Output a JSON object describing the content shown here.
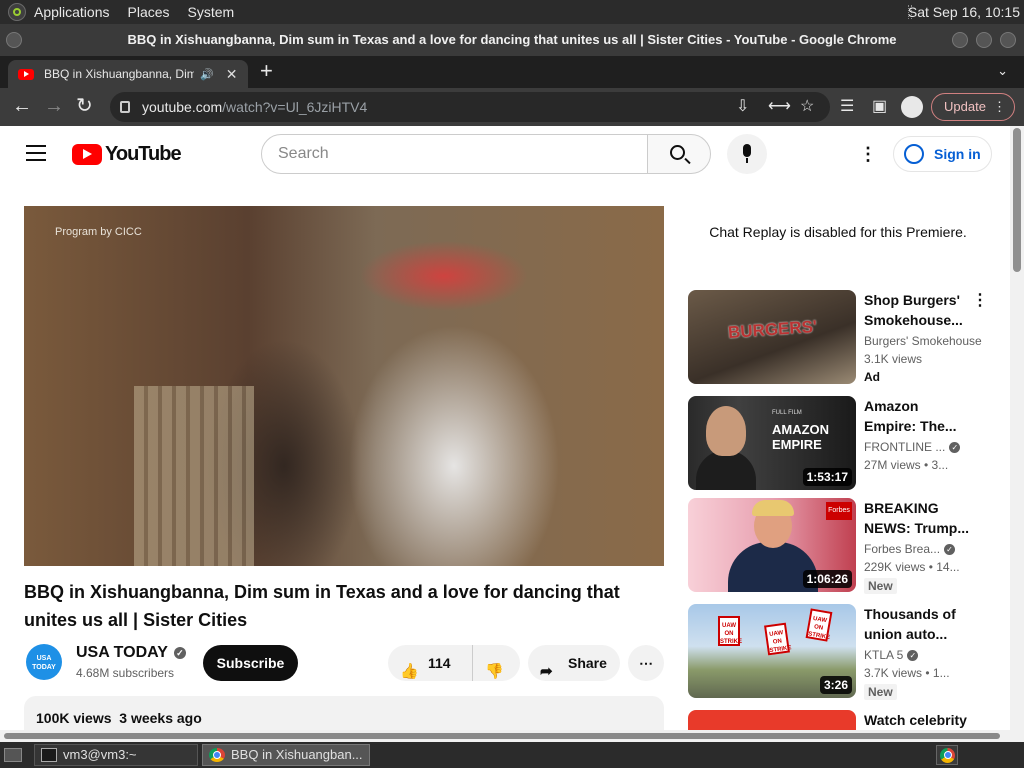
{
  "desktop": {
    "menus": [
      "Applications",
      "Places",
      "System"
    ],
    "clock": "Sat Sep 16, 10:15"
  },
  "window": {
    "title": "BBQ in Xishuangbanna, Dim sum in Texas and a love for dancing that unites us all | Sister Cities - YouTube - Google Chrome"
  },
  "browser": {
    "tab_title": "BBQ in Xishuangbanna, Dim sum in Texas and a love for dancing that unites us all | Sister Cities - YouTube",
    "url_domain": "youtube.com",
    "url_path": "/watch?v=Ul_6JziHTV4",
    "update_label": "Update"
  },
  "youtube": {
    "logo_text": "YouTube",
    "search_placeholder": "Search",
    "signin_label": "Sign in",
    "video": {
      "watermark": "Program by CICC",
      "title": "BBQ in Xishuangbanna, Dim sum in Texas and a love for dancing that unites us all | Sister Cities",
      "channel": "USA TODAY",
      "avatar_text": "USA TODAY",
      "subscribers": "4.68M subscribers",
      "subscribe_label": "Subscribe",
      "likes": "114",
      "share_label": "Share",
      "views": "100K views",
      "age": "3 weeks ago"
    },
    "chat_replay": "Chat Replay is disabled for this Premiere.",
    "recommendations": [
      {
        "title1": "Shop Burgers'",
        "title2": "Smokehouse...",
        "channel": "Burgers' Smokehouse",
        "meta": "3.1K views",
        "badge": "Ad",
        "thumb_text": "BURGERS'"
      },
      {
        "title1": "Amazon",
        "title2": "Empire: The...",
        "channel": "FRONTLINE ...",
        "meta": "27M views • 3...",
        "duration": "1:53:17",
        "thumb_big": "AMAZON EMPIRE",
        "thumb_small": "FULL FILM"
      },
      {
        "title1": "BREAKING",
        "title2": "NEWS: Trump...",
        "channel": "Forbes Brea...",
        "meta": "229K views • 14...",
        "duration": "1:06:26",
        "badge": "New",
        "thumb_text": "Forbes"
      },
      {
        "title1": "Thousands of",
        "title2": "union auto...",
        "channel": "KTLA 5",
        "meta": "3.7K views • 1...",
        "duration": "3:26",
        "badge": "New",
        "thumb_text": "UAW ON STRIKE"
      },
      {
        "title1": "Watch celebrity"
      }
    ]
  },
  "taskbar": {
    "items": [
      "vm3@vm3:~",
      "BBQ in Xishuangban..."
    ]
  }
}
